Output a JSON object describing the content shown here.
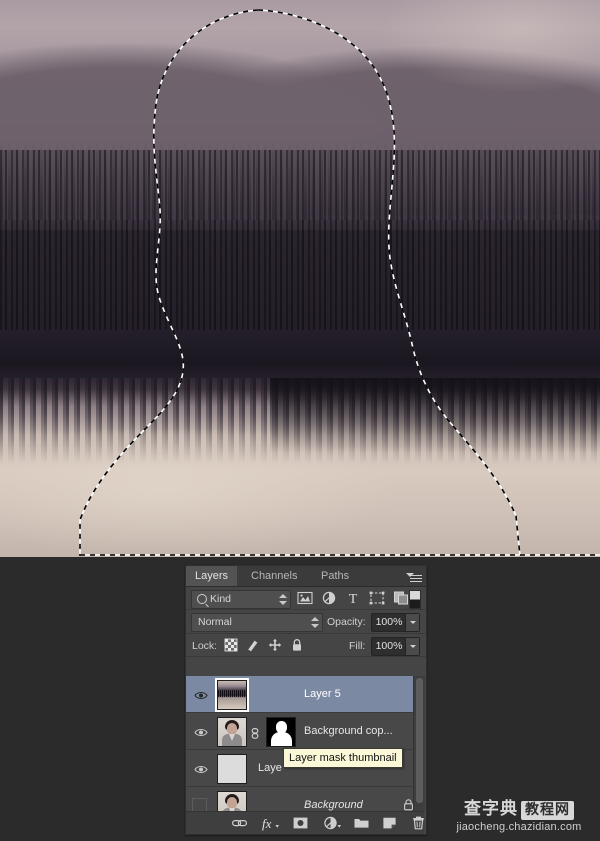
{
  "canvas": {
    "description": "Sepia-toned photo of a forested mountain reflected in a lake",
    "selection": "marching-ants head-and-shoulders silhouette selection"
  },
  "panel": {
    "tabs": [
      {
        "label": "Layers",
        "active": true
      },
      {
        "label": "Channels",
        "active": false
      },
      {
        "label": "Paths",
        "active": false
      }
    ],
    "menu_icon": "panel-menu-icon",
    "filter": {
      "kind_label": "Kind",
      "search_icon": "search-icon",
      "icons": [
        "pixel-layers-filter-icon",
        "adjustment-layers-filter-icon",
        "type-layers-filter-icon",
        "shape-layers-filter-icon",
        "smart-object-filter-icon"
      ],
      "toggle_icon": "filter-toggle-switch"
    },
    "blend": {
      "mode": "Normal",
      "opacity_label": "Opacity:",
      "opacity_value": "100%",
      "fill_label": "Fill:",
      "fill_value": "100%"
    },
    "lock": {
      "label": "Lock:",
      "icons": [
        "lock-transparent-pixels-icon",
        "lock-image-pixels-icon",
        "lock-position-icon",
        "lock-all-icon"
      ]
    },
    "layers": [
      {
        "name": "Layer 5",
        "visible": true,
        "selected": true,
        "thumb": "landscape",
        "thumb_active": true,
        "has_mask": false,
        "locked": false,
        "italic": false
      },
      {
        "name": "Background cop...",
        "visible": true,
        "selected": false,
        "thumb": "portrait",
        "thumb_active": false,
        "has_mask": true,
        "mask_link_icon": "mask-link-icon",
        "locked": false,
        "italic": false
      },
      {
        "name": "Laye",
        "visible": true,
        "selected": false,
        "thumb": "plain",
        "thumb_active": false,
        "has_mask": false,
        "locked": false,
        "italic": false
      },
      {
        "name": "Background",
        "visible": false,
        "selected": false,
        "thumb": "portrait",
        "thumb_active": false,
        "has_mask": false,
        "locked": true,
        "lock_icon": "layer-lock-icon",
        "italic": true
      }
    ],
    "toolbar": [
      "link-layers-icon",
      "layer-style-fx-icon",
      "add-layer-mask-icon",
      "new-adjustment-layer-icon",
      "new-group-icon",
      "new-layer-icon",
      "delete-layer-icon"
    ]
  },
  "tooltip": {
    "text": "Layer mask thumbnail"
  },
  "watermark": {
    "cn_main": "查字典",
    "cn_boxed": "教程网",
    "url": "jiaocheng.chazidian.com"
  },
  "colors": {
    "panel_bg": "#454545",
    "selection_blue": "#7b8aa2",
    "workspace_bg": "#2b2b2b",
    "tooltip_bg": "#fbf8d8",
    "text": "#e6e6e6"
  }
}
